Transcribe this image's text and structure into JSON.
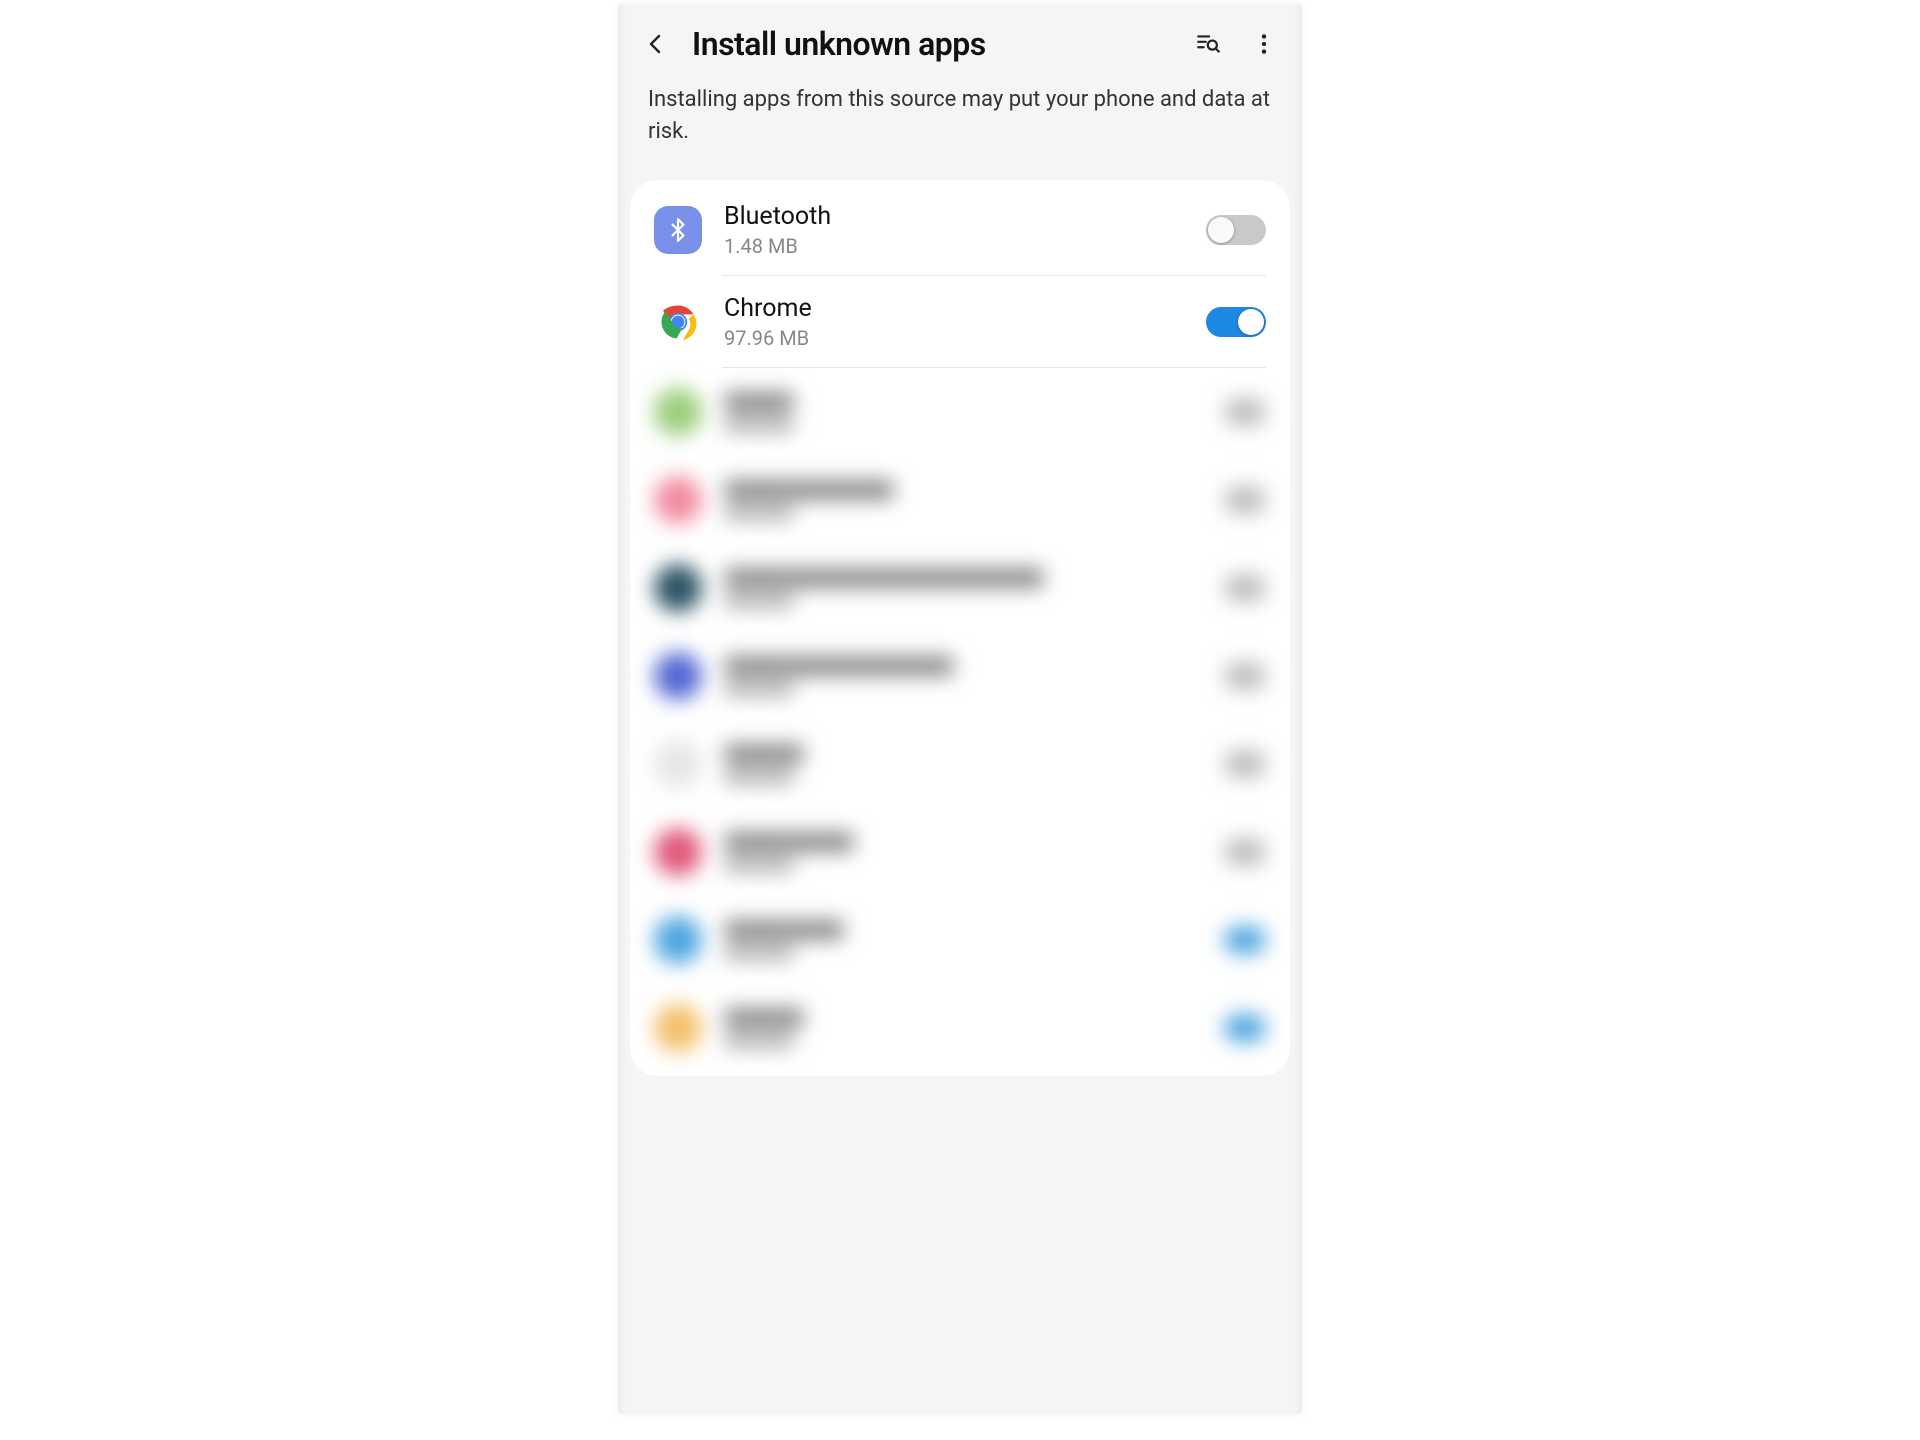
{
  "header": {
    "title": "Install unknown apps",
    "subtitle": "Installing apps from this source may put your phone and data at risk."
  },
  "apps": [
    {
      "name": "Bluetooth",
      "size": "1.48 MB",
      "enabled": false,
      "icon": "bluetooth"
    },
    {
      "name": "Chrome",
      "size": "97.96 MB",
      "enabled": true,
      "icon": "chrome"
    }
  ],
  "blurred_rows": [
    {
      "icon_color": "#9bce7a",
      "line_w": 70,
      "toggle_color": "#bdbdbd"
    },
    {
      "icon_color": "#f28ca0",
      "line_w": 170,
      "toggle_color": "#bdbdbd"
    },
    {
      "icon_color": "#2c5364",
      "line_w": 320,
      "toggle_color": "#bdbdbd"
    },
    {
      "icon_color": "#5468d4",
      "line_w": 230,
      "toggle_color": "#bdbdbd"
    },
    {
      "icon_color": "#e6e6e6",
      "line_w": 80,
      "toggle_color": "#bdbdbd"
    },
    {
      "icon_color": "#e05a7a",
      "line_w": 130,
      "toggle_color": "#bdbdbd"
    },
    {
      "icon_color": "#4fa6e0",
      "line_w": 120,
      "toggle_color": "#4fa6e0"
    },
    {
      "icon_color": "#f4c06b",
      "line_w": 80,
      "toggle_color": "#4fa6e0"
    }
  ],
  "colors": {
    "accent_on": "#1e88e5",
    "toggle_off": "#c9c9c9",
    "bluetooth_bg": "#7890e8"
  }
}
